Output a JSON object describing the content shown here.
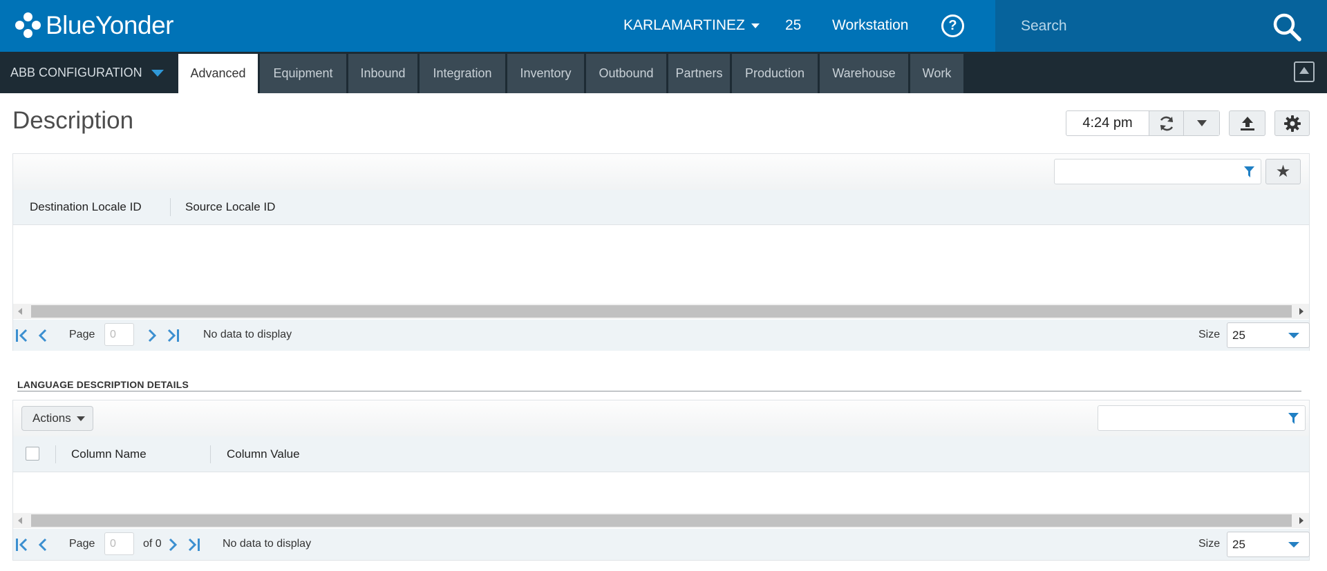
{
  "header": {
    "brand": "BlueYonder",
    "user": "KARLAMARTINEZ",
    "warehouse_number": "25",
    "workstation": "Workstation",
    "help": "?",
    "search_placeholder": "Search"
  },
  "nav": {
    "app": "ABB CONFIGURATION",
    "tabs": [
      {
        "label": "Advanced",
        "active": true
      },
      {
        "label": "Equipment"
      },
      {
        "label": "Inbound"
      },
      {
        "label": "Integration"
      },
      {
        "label": "Inventory"
      },
      {
        "label": "Outbound"
      },
      {
        "label": "Partners"
      },
      {
        "label": "Production"
      },
      {
        "label": "Warehouse"
      },
      {
        "label": "Work"
      }
    ]
  },
  "page": {
    "title": "Description",
    "time": "4:24 pm"
  },
  "grid1": {
    "columns": [
      "Destination Locale ID",
      "Source Locale ID"
    ],
    "page_label": "Page",
    "page_value": "0",
    "status": "No data to display",
    "size_label": "Size",
    "size_value": "25"
  },
  "section": {
    "title": "LANGUAGE DESCRIPTION DETAILS"
  },
  "grid2": {
    "actions_label": "Actions",
    "columns": [
      "Column Name",
      "Column Value"
    ],
    "page_label": "Page",
    "page_value": "0",
    "of_label": "of 0",
    "status": "No data to display",
    "size_label": "Size",
    "size_value": "25"
  },
  "colors": {
    "header_blue": "#0073b7",
    "nav_dark": "#1d2b34",
    "tab_gray": "#3a4a55",
    "accent_blue": "#2f98d8"
  }
}
